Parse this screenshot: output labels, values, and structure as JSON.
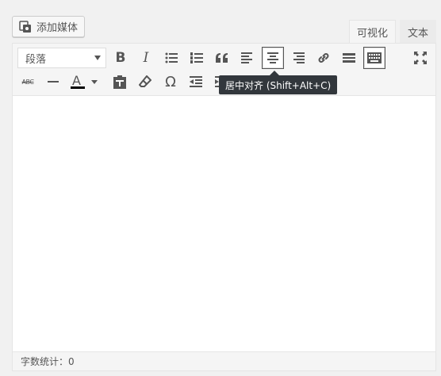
{
  "media": {
    "label": "添加媒体",
    "icon": "media-camera-icon"
  },
  "tabs": {
    "visual": "可视化",
    "text": "文本"
  },
  "toolbar": {
    "format_select": "段落",
    "tooltip": "居中对齐 (Shift+Alt+C)",
    "row1": [
      "bold-icon",
      "italic-icon",
      "bullet-list-icon",
      "numbered-list-icon",
      "blockquote-icon",
      "align-left-icon",
      "align-center-icon",
      "align-right-icon",
      "link-icon",
      "read-more-icon",
      "toolbar-toggle-icon",
      "fullscreen-icon"
    ],
    "row2": [
      "strikethrough-icon",
      "horizontal-line-icon",
      "text-color-icon",
      "paste-text-icon",
      "clear-formatting-icon",
      "special-character-icon",
      "outdent-icon",
      "indent-icon"
    ]
  },
  "status": {
    "word_count": "字数统计：0"
  }
}
